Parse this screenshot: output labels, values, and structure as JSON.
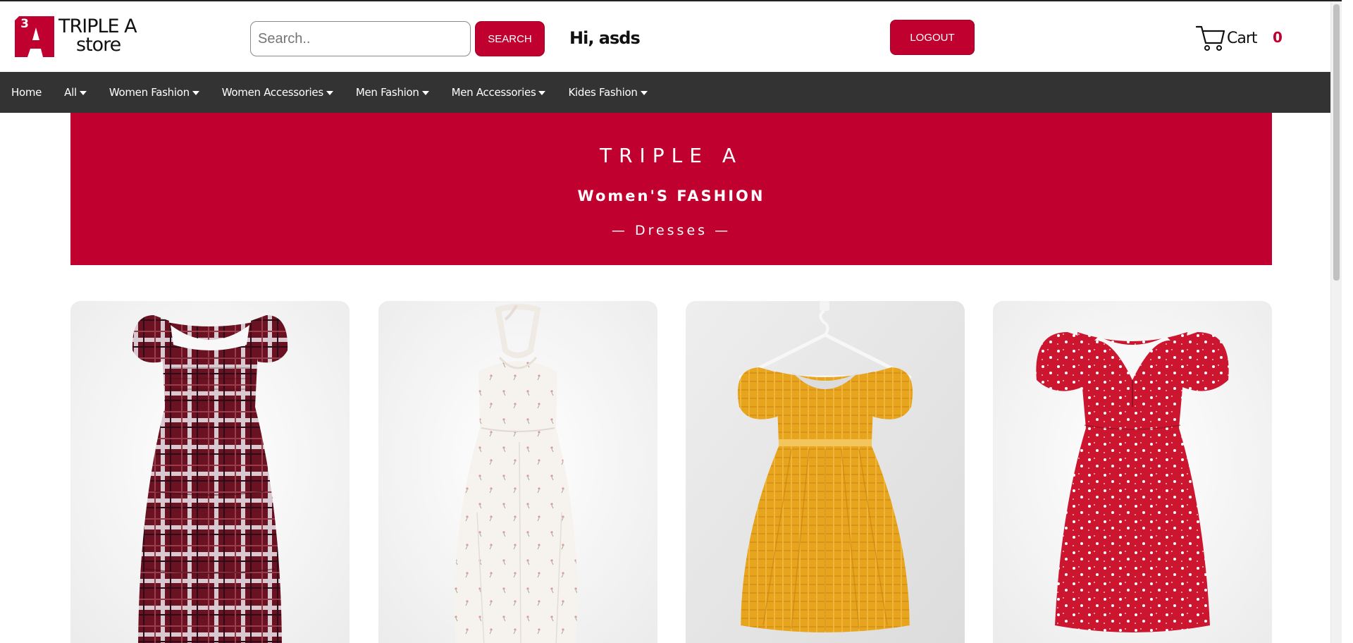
{
  "header": {
    "logo": {
      "line1": "TRIPLE A",
      "line2": "store",
      "mark_text": "3"
    },
    "search": {
      "placeholder": "Search..",
      "value": "",
      "button_label": "SEARCH"
    },
    "greeting": "Hi, asds",
    "logout_label": "LOGOUT",
    "cart": {
      "label": "Cart",
      "count": "0"
    }
  },
  "nav": {
    "items": [
      {
        "label": "Home",
        "dropdown": false
      },
      {
        "label": "All",
        "dropdown": true
      },
      {
        "label": "Women Fashion",
        "dropdown": true
      },
      {
        "label": "Women Accessories",
        "dropdown": true
      },
      {
        "label": "Men Fashion",
        "dropdown": true
      },
      {
        "label": "Men Accessories",
        "dropdown": true
      },
      {
        "label": "Kides Fashion",
        "dropdown": true
      }
    ]
  },
  "banner": {
    "title": "TRIPLE A",
    "subtitle": "Women'S FASHION",
    "category": "— Dresses —"
  },
  "products": [
    {
      "name": "plaid-dress",
      "colors": [
        "#6b1222",
        "#ffffff"
      ]
    },
    {
      "name": "white-halter-dress",
      "colors": [
        "#f4f1ec"
      ]
    },
    {
      "name": "yellow-puff-sleeve-dress",
      "colors": [
        "#e7a41d"
      ]
    },
    {
      "name": "red-floral-dress",
      "colors": [
        "#cc1630"
      ]
    }
  ],
  "colors": {
    "accent": "#c0002e",
    "navbar": "#333333"
  }
}
